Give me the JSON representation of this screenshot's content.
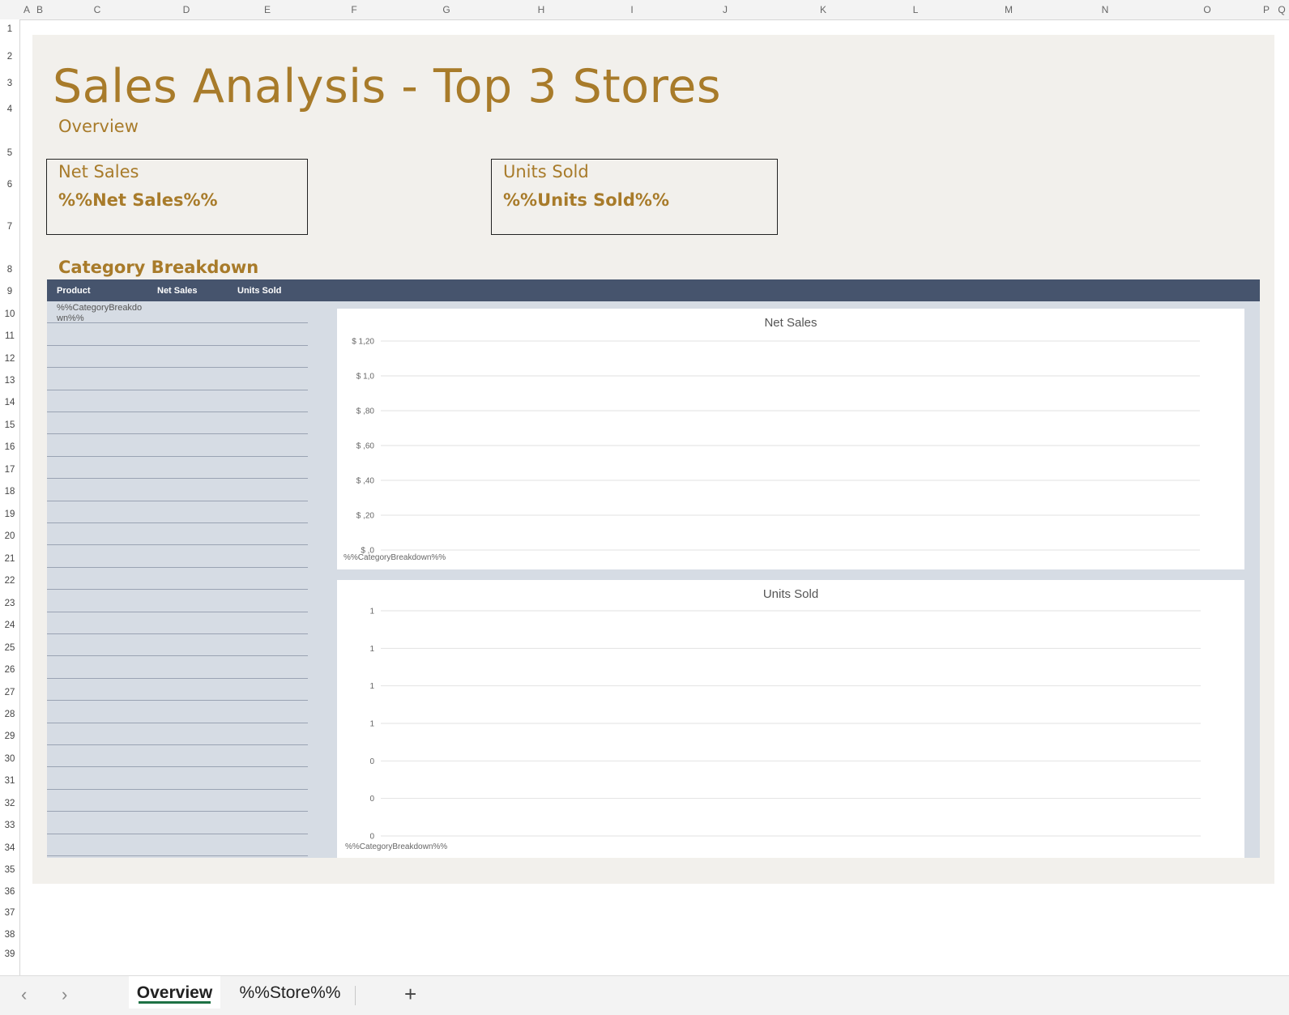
{
  "column_headers": [
    "A",
    "B",
    "C",
    "D",
    "E",
    "F",
    "G",
    "H",
    "I",
    "J",
    "K",
    "L",
    "M",
    "N",
    "O",
    "P",
    "Q"
  ],
  "row_headers": [
    "1",
    "2",
    "3",
    "4",
    "5",
    "6",
    "7",
    "8",
    "9",
    "10",
    "11",
    "12",
    "13",
    "14",
    "15",
    "16",
    "17",
    "18",
    "19",
    "20",
    "21",
    "22",
    "23",
    "24",
    "25",
    "26",
    "27",
    "28",
    "29",
    "30",
    "31",
    "32",
    "33",
    "34",
    "35",
    "36",
    "37",
    "38",
    "39"
  ],
  "sheet": {
    "title": "Sales Analysis - Top 3 Stores",
    "subtitle": "Overview",
    "kpi_net_sales": {
      "label": "Net Sales",
      "value": "%%Net Sales%%"
    },
    "kpi_units_sold": {
      "label": "Units Sold",
      "value": "%%Units Sold%%"
    },
    "section_title": "Category Breakdown",
    "table": {
      "headers": [
        "Product",
        "Net Sales",
        "Units Sold"
      ],
      "first_cell": "%%CategoryBreakdown%%"
    }
  },
  "chart_data": [
    {
      "type": "bar",
      "title": "Net Sales",
      "categories": [
        "%%CategoryBreakdown%%"
      ],
      "values": [],
      "y_tick_labels": [
        "$ 1,20",
        "$ 1,0",
        "$ ,80",
        "$ ,60",
        "$ ,40",
        "$ ,20",
        "$ ,0"
      ],
      "ylim": [
        0,
        1.2
      ],
      "grid": true
    },
    {
      "type": "bar",
      "title": "Units Sold",
      "categories": [
        "%%CategoryBreakdown%%"
      ],
      "values": [],
      "y_tick_labels": [
        "1",
        "1",
        "1",
        "1",
        "0",
        "0",
        "0"
      ],
      "ylim": [
        0,
        1.2
      ],
      "grid": true
    }
  ],
  "tabs": {
    "prev_icon": "chevron-left-icon",
    "next_icon": "chevron-right-icon",
    "items": [
      {
        "label": "Overview",
        "active": true
      },
      {
        "label": "%%Store%%",
        "active": false
      }
    ],
    "add_icon": "plus-icon"
  },
  "colors": {
    "title": "#a87b2a",
    "header_bg": "#46546d",
    "region_bg": "#d6dce4",
    "sheet_bg": "#f2f0ec",
    "active_tab_underline": "#1e7145"
  }
}
